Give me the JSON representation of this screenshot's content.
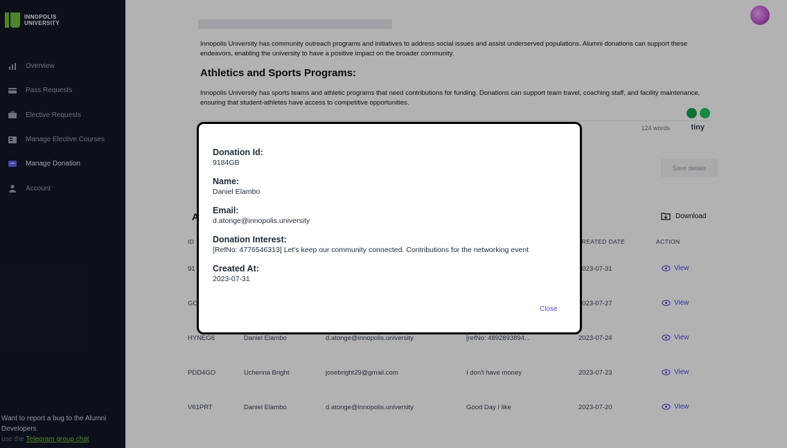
{
  "sidebar": {
    "logo_line1": "INNOPOLIS",
    "logo_line2": "UNIVERSITY",
    "items": [
      {
        "label": "Overview",
        "icon": "bar-chart-icon"
      },
      {
        "label": "Pass Requests",
        "icon": "card-icon"
      },
      {
        "label": "Elective Requests",
        "icon": "briefcase-icon"
      },
      {
        "label": "Manage Elective Courses",
        "icon": "book-icon"
      },
      {
        "label": "Manage Donation",
        "icon": "donation-icon"
      },
      {
        "label": "Account",
        "icon": "user-icon"
      }
    ],
    "active": "Manage Donation",
    "bug_text": "Want to report a bug to the Alumni Developers",
    "bug_prefix": "use the",
    "bug_link": "Telegram group chat"
  },
  "editor": {
    "para1": "Innopolis University has community outreach programs and initiatives to address social issues and assist underserved populations. Alumni donations can support these endeavors, enabling the university to have a positive impact on the broader community.",
    "heading": "Athletics and Sports Programs:",
    "para2": "Innopolis University has sports teams and athletic programs that need contributions for funding. Donations can support team travel, coaching staff, and facility maintenance, ensuring that student-athletes have access to competitive opportunities.",
    "word_count": "124 words",
    "tiny_brand": "tiny",
    "save_label": "Save details"
  },
  "table": {
    "title": "A",
    "download_label": "Download",
    "headers": {
      "id": "ID",
      "created": "CREATED DATE",
      "action": "ACTION"
    },
    "view_label": "View",
    "rows": [
      {
        "id": "91",
        "name": "",
        "email": "",
        "interest": "",
        "date": "2023-07-31"
      },
      {
        "id": "GC",
        "name": "",
        "email": "",
        "interest": "",
        "date": "2023-07-27"
      },
      {
        "id": "HYNEG6",
        "name": "Daniel Elambo",
        "email": "d.atonge@innopolis.university",
        "interest": "[refNo: 4892893894...",
        "date": "2023-07-24"
      },
      {
        "id": "PDD4GO",
        "name": "Uchenna Bright",
        "email": "josebright29@gmail.com",
        "interest": "I don't have money",
        "date": "2023-07-23"
      },
      {
        "id": "V61PRT",
        "name": "Daniel Elambo",
        "email": "d.atonge@innopolis.university",
        "interest": "Good Day I likе",
        "date": "2023-07-20"
      }
    ]
  },
  "modal": {
    "donation_id_label": "Donation Id:",
    "donation_id": "9184GB",
    "name_label": "Name:",
    "name": "Daniel Elambo",
    "email_label": "Email:",
    "email": "d.atonge@innopolis.university",
    "interest_label": "Donation Interest:",
    "interest": "[RefNo: 4776546313] Let's keep our community connected. Contributions for the networking event",
    "created_label": "Created At:",
    "created": "2023-07-31",
    "close_label": "Close"
  },
  "colors": {
    "sidebar_bg": "#111827",
    "accent": "#4f46e5",
    "logo_green": "#6fbf3a"
  }
}
